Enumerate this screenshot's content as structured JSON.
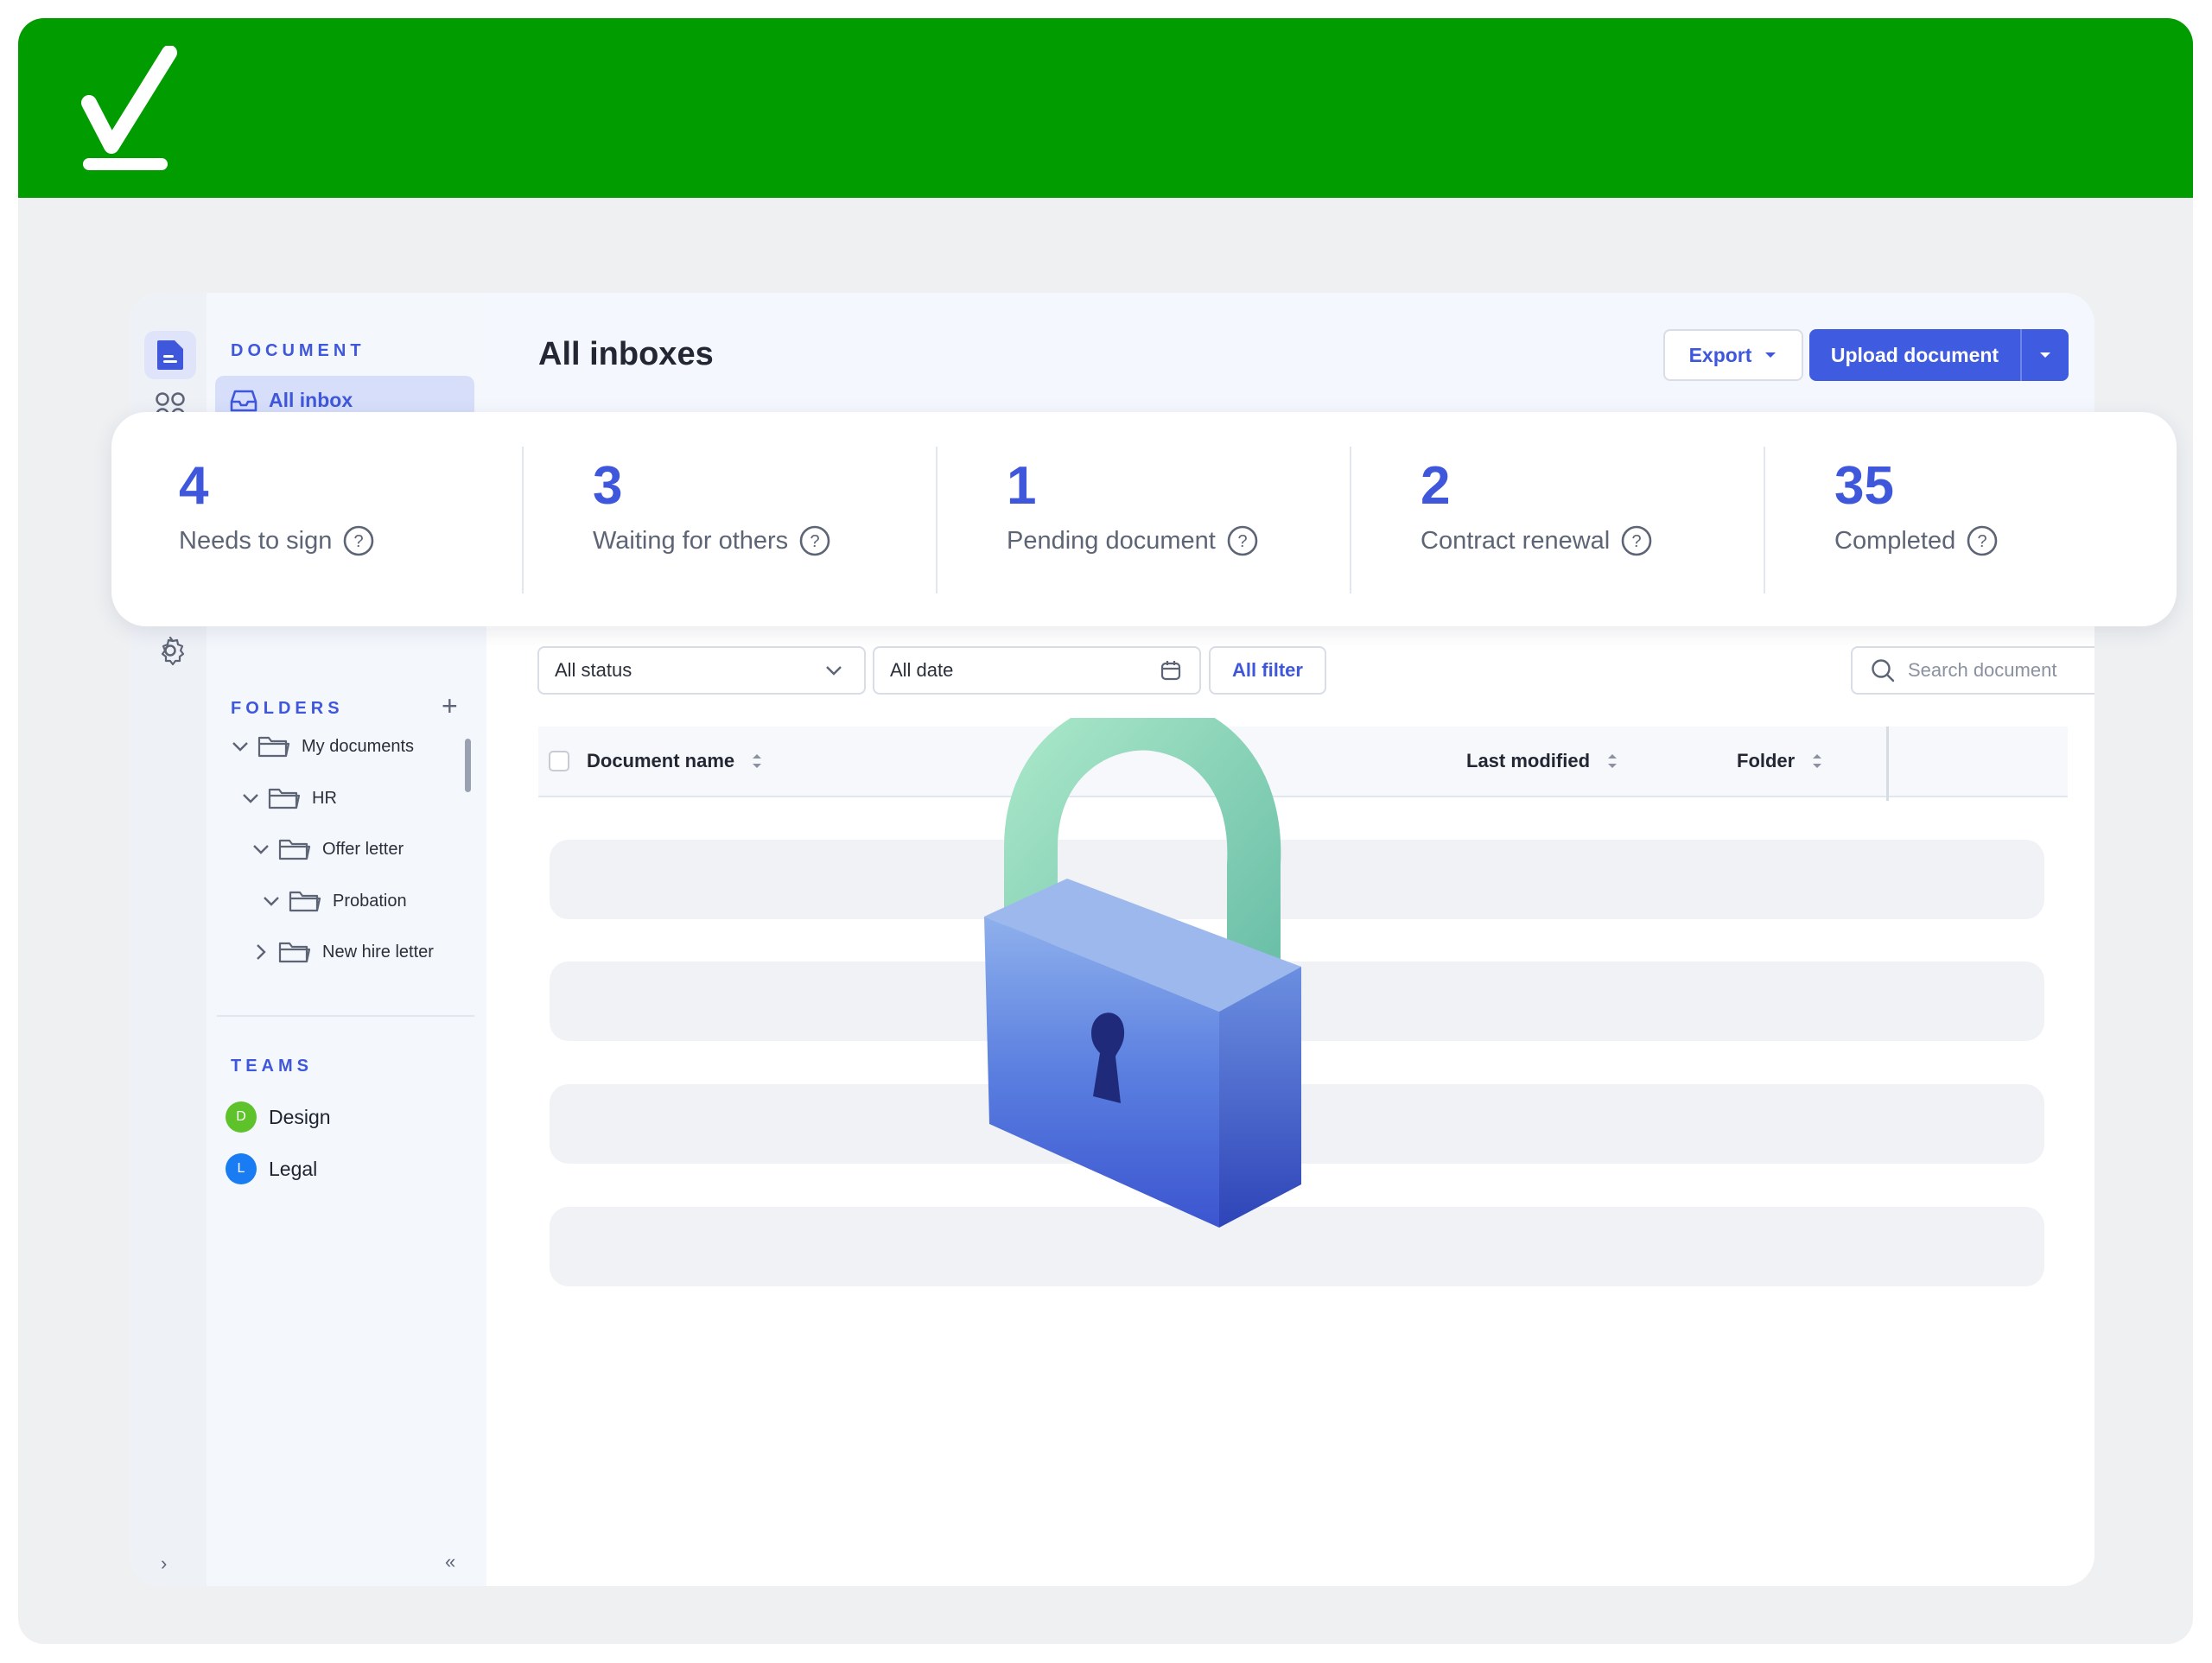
{
  "brand": {
    "banner_color": "#009c00",
    "logo_icon": "checkmark-icon"
  },
  "sidebar": {
    "document_title": "DOCUMENT",
    "active_item": "All inbox",
    "folders_title": "FOLDERS",
    "folders": [
      {
        "label": "My documents",
        "expanded": true
      },
      {
        "label": "HR",
        "expanded": true
      },
      {
        "label": "Offer letter",
        "expanded": true
      },
      {
        "label": "Probation",
        "expanded": true
      },
      {
        "label": "New hire letter",
        "expanded": false
      }
    ],
    "teams_title": "TEAMS",
    "teams": [
      {
        "initial": "D",
        "label": "Design",
        "color": "#5ec22a"
      },
      {
        "initial": "L",
        "label": "Legal",
        "color": "#1a7cf2"
      }
    ]
  },
  "header": {
    "title": "All inboxes",
    "export_label": "Export",
    "upload_label": "Upload document"
  },
  "stats": [
    {
      "value": "4",
      "label": "Needs to sign"
    },
    {
      "value": "3",
      "label": "Waiting for others"
    },
    {
      "value": "1",
      "label": "Pending document"
    },
    {
      "value": "2",
      "label": "Contract renewal"
    },
    {
      "value": "35",
      "label": "Completed"
    }
  ],
  "filters": {
    "status": "All status",
    "date": "All date",
    "all_filter": "All filter",
    "search_placeholder": "Search document"
  },
  "table": {
    "columns": [
      "Document name",
      "Last modified",
      "Folder"
    ]
  },
  "colors": {
    "accent": "#3f57db",
    "primary_button": "#3f5ce0"
  }
}
